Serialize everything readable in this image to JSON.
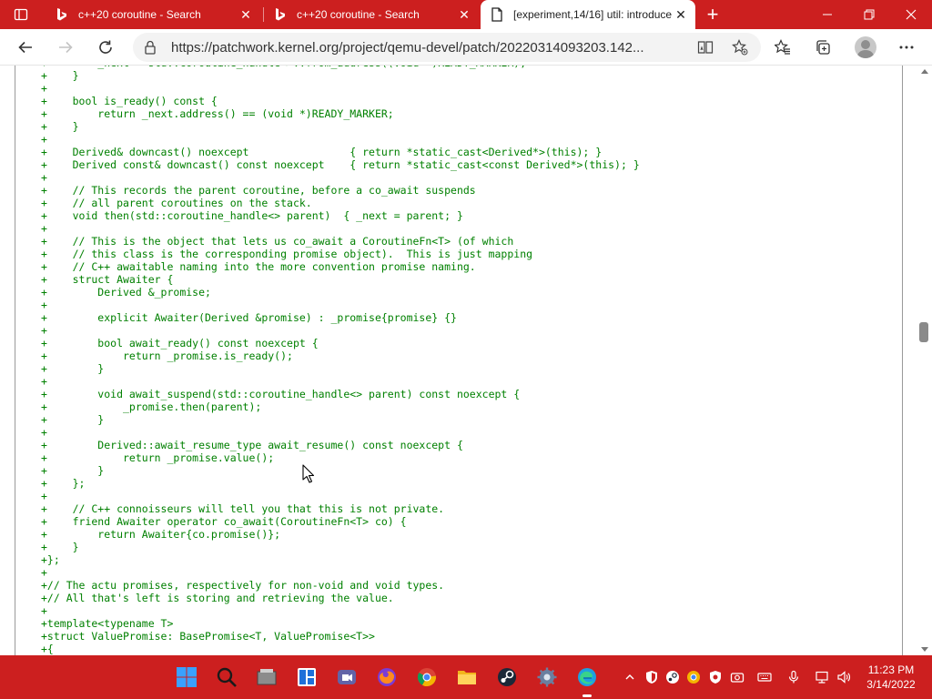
{
  "browser": {
    "tabs": [
      {
        "title": "c++20 coroutine - Search",
        "icon": "bing-icon"
      },
      {
        "title": "c++20 coroutine - Search",
        "icon": "bing-icon"
      },
      {
        "title": "[experiment,14/16] util: introduce",
        "icon": "page-icon",
        "active": true
      }
    ],
    "address_url": "https://patchwork.kernel.org/project/qemu-devel/patch/20220314093203.142..."
  },
  "code_lines": [
    "+        _next = std::coroutine_handle<>::from_address((void *)READY_MARKER);",
    "+    }",
    "+",
    "+    bool is_ready() const {",
    "+        return _next.address() == (void *)READY_MARKER;",
    "+    }",
    "+",
    "+    Derived& downcast() noexcept                { return *static_cast<Derived*>(this); }",
    "+    Derived const& downcast() const noexcept    { return *static_cast<const Derived*>(this); }",
    "+",
    "+    // This records the parent coroutine, before a co_await suspends",
    "+    // all parent coroutines on the stack.",
    "+    void then(std::coroutine_handle<> parent)  { _next = parent; }",
    "+",
    "+    // This is the object that lets us co_await a CoroutineFn<T> (of which",
    "+    // this class is the corresponding promise object).  This is just mapping",
    "+    // C++ awaitable naming into the more convention promise naming.",
    "+    struct Awaiter {",
    "+        Derived &_promise;",
    "+",
    "+        explicit Awaiter(Derived &promise) : _promise{promise} {}",
    "+",
    "+        bool await_ready() const noexcept {",
    "+            return _promise.is_ready();",
    "+        }",
    "+",
    "+        void await_suspend(std::coroutine_handle<> parent) const noexcept {",
    "+            _promise.then(parent);",
    "+        }",
    "+",
    "+        Derived::await_resume_type await_resume() const noexcept {",
    "+            return _promise.value();",
    "+        }",
    "+    };",
    "+",
    "+    // C++ connoisseurs will tell you that this is not private.",
    "+    friend Awaiter operator co_await(CoroutineFn<T> co) {",
    "+        return Awaiter{co.promise()};",
    "+    }",
    "+};",
    "+",
    "+// The actu promises, respectively for non-void and void types.",
    "+// All that's left is storing and retrieving the value.",
    "+",
    "+template<typename T>",
    "+struct ValuePromise: BasePromise<T, ValuePromise<T>>",
    "+{"
  ],
  "taskbar": {
    "clock_time": "11:23 PM",
    "clock_date": "3/14/2022"
  }
}
